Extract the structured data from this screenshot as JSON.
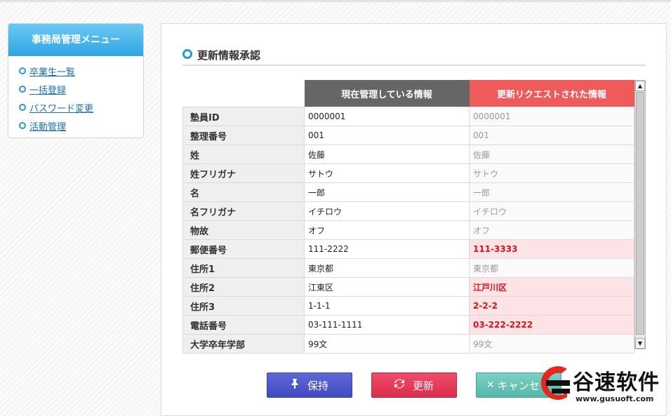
{
  "sidebar": {
    "title": "事務局管理メニュー",
    "items": [
      {
        "label": "卒業生一覧"
      },
      {
        "label": "一括登録"
      },
      {
        "label": "パスワード変更"
      },
      {
        "label": "活動管理"
      }
    ]
  },
  "main": {
    "title": "更新情報承認",
    "columns": {
      "current": "現在管理している情報",
      "request": "更新リクエストされた情報"
    },
    "rows": [
      {
        "label": "塾員ID",
        "current": "0000001",
        "request": "0000001",
        "changed": false
      },
      {
        "label": "整理番号",
        "current": "001",
        "request": "001",
        "changed": false
      },
      {
        "label": "姓",
        "current": "佐藤",
        "request": "佐藤",
        "changed": false
      },
      {
        "label": "姓フリガナ",
        "current": "サトウ",
        "request": "サトウ",
        "changed": false
      },
      {
        "label": "名",
        "current": "一郎",
        "request": "一郎",
        "changed": false
      },
      {
        "label": "名フリガナ",
        "current": "イチロウ",
        "request": "イチロウ",
        "changed": false
      },
      {
        "label": "物故",
        "current": "オフ",
        "request": "オフ",
        "changed": false
      },
      {
        "label": "郵便番号",
        "current": "111-2222",
        "request": "111-3333",
        "changed": true
      },
      {
        "label": "住所1",
        "current": "東京都",
        "request": "東京都",
        "changed": false
      },
      {
        "label": "住所2",
        "current": "江東区",
        "request": "江戸川区",
        "changed": true
      },
      {
        "label": "住所3",
        "current": "1-1-1",
        "request": "2-2-2",
        "changed": true
      },
      {
        "label": "電話番号",
        "current": "03-111-1111",
        "request": "03-222-2222",
        "changed": true
      },
      {
        "label": "大学卒年学部",
        "current": "99文",
        "request": "99文",
        "changed": false
      }
    ]
  },
  "buttons": {
    "hold": "保持",
    "update": "更新",
    "cancel": "キャンセ"
  },
  "watermark": {
    "brand": "谷速软件",
    "url": "www.gusuoft.com"
  },
  "colors": {
    "accent": "#2ea6e2",
    "request_header": "#ef5a5a",
    "current_header": "#666666",
    "changed_text": "#d8141b",
    "changed_bg": "#fde3e5"
  },
  "icons": {
    "bullet": "circle-bullet-icon",
    "hold": "pin-icon",
    "update": "refresh-icon",
    "cancel": "close-icon"
  }
}
